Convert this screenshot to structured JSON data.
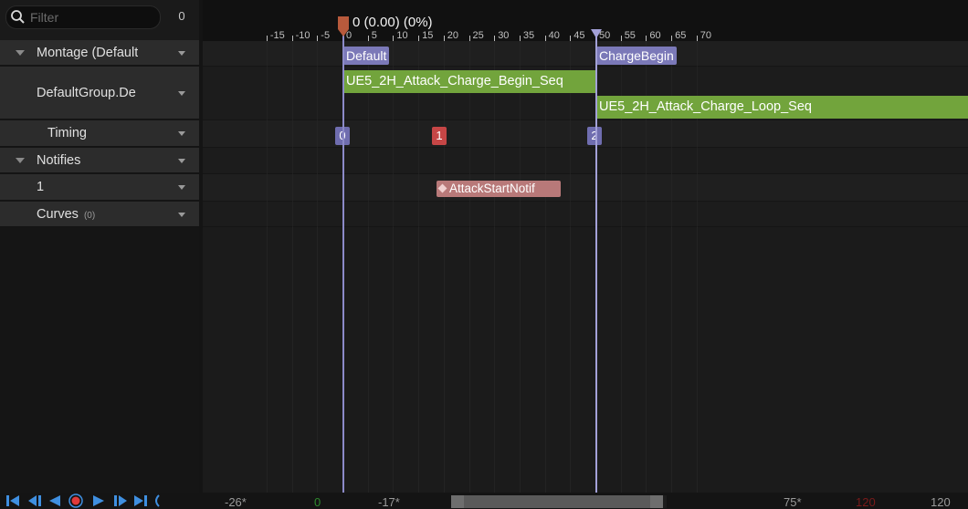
{
  "filter": {
    "placeholder": "Filter",
    "count": "0"
  },
  "tracks": [
    {
      "label": "Montage (Default",
      "expand": true
    },
    {
      "label": "DefaultGroup.De"
    },
    {
      "label": "Timing"
    },
    {
      "label": "Notifies",
      "expand": true
    },
    {
      "label": "1"
    },
    {
      "label": "Curves",
      "count": "(0)"
    }
  ],
  "ruler": {
    "labels": [
      "-15",
      "-10",
      "-5",
      "0",
      "5",
      "10",
      "15",
      "20",
      "25",
      "30",
      "35",
      "40",
      "45",
      "50",
      "55",
      "60",
      "65",
      "70"
    ],
    "scrub_text": "0 (0.00) (0%)"
  },
  "sections": [
    {
      "name": "Default"
    },
    {
      "name": "ChargeBegin"
    }
  ],
  "segments": [
    {
      "name": "UE5_2H_Attack_Charge_Begin_Seq"
    },
    {
      "name": "UE5_2H_Attack_Charge_Loop_Seq"
    }
  ],
  "timing_badges": [
    "0",
    "1",
    "2"
  ],
  "notifies": [
    {
      "name": "AttackStartNotif"
    }
  ],
  "bottom": {
    "view_start": "-26*",
    "work_start": "0",
    "range_start": "-17*",
    "range_end": "75*",
    "work_end": "120",
    "view_end": "120"
  },
  "colors": {
    "section": "#7b79b8",
    "segment": "#72a43c",
    "notify": "#b87979",
    "timing_red": "#c64646",
    "playhead": "#b85a3c"
  },
  "icons": [
    "search-icon",
    "go-to-start-icon",
    "step-back-icon",
    "play-reverse-icon",
    "record-icon",
    "play-icon",
    "step-forward-icon",
    "go-to-end-icon",
    "loop-icon"
  ]
}
